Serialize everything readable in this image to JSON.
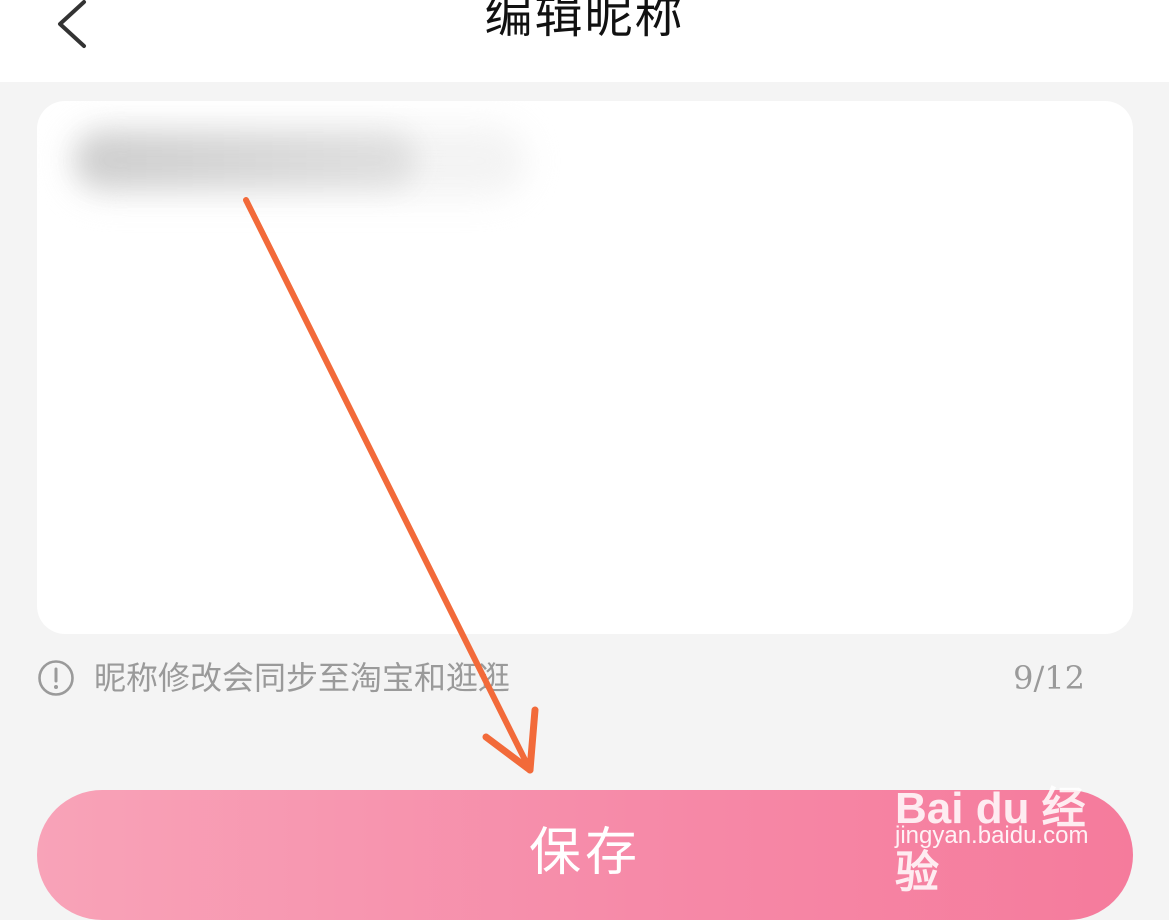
{
  "header": {
    "title": "编辑昵称",
    "back_icon": "chevron-left-icon"
  },
  "nickname": {
    "value": "",
    "value_obscured": true
  },
  "hint": {
    "icon": "info-circle-icon",
    "text": "昵称修改会同步至淘宝和逛逛",
    "counter": "9/12"
  },
  "actions": {
    "save_label": "保存"
  },
  "annotation": {
    "arrow_color": "#f26a3a"
  },
  "watermark": {
    "brand": "Bai du 经验",
    "url": "jingyan.baidu.com"
  },
  "colors": {
    "background": "#f4f4f4",
    "card": "#ffffff",
    "hint_text": "#9a9a9a",
    "button_gradient_start": "#f8a3b8",
    "button_gradient_end": "#f57b9c",
    "button_text": "#ffffff"
  }
}
